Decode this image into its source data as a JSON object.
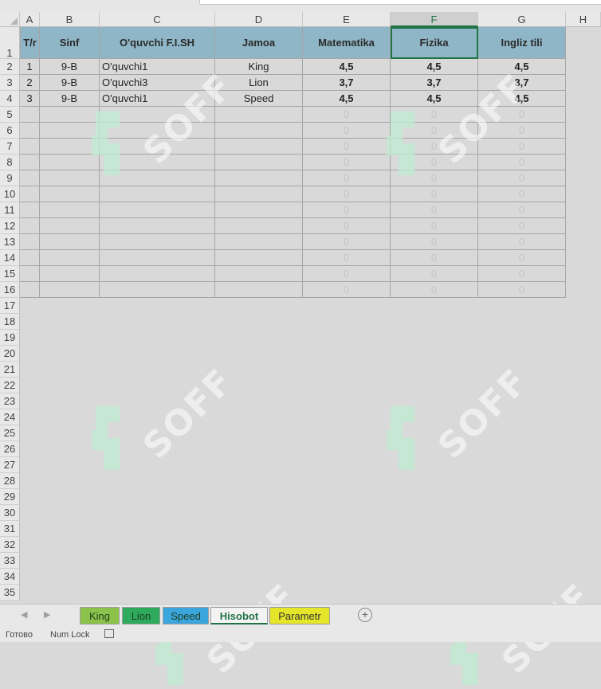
{
  "columns": [
    "A",
    "B",
    "C",
    "D",
    "E",
    "F",
    "G",
    "H"
  ],
  "selected_column": "F",
  "header_row": {
    "tr": "T/r",
    "sinf": "Sinf",
    "fish": "O'quvchi F.I.SH",
    "jamoa": "Jamoa",
    "matematika": "Matematika",
    "fizika": "Fizika",
    "ingliz": "Ingliz tili"
  },
  "data_rows": [
    {
      "tr": "1",
      "sinf": "9-B",
      "fish": "O'quvchi1",
      "jamoa": "King",
      "matematika": "4,5",
      "fizika": "4,5",
      "ingliz": "4,5"
    },
    {
      "tr": "2",
      "sinf": "9-B",
      "fish": "O'quvchi3",
      "jamoa": "Lion",
      "matematika": "3,7",
      "fizika": "3,7",
      "ingliz": "3,7"
    },
    {
      "tr": "3",
      "sinf": "9-B",
      "fish": "O'quvchi1",
      "jamoa": "Speed",
      "matematika": "4,5",
      "fizika": "4,5",
      "ingliz": "4,5"
    }
  ],
  "zero_value": "0",
  "row_numbers": [
    "1",
    "2",
    "3",
    "4",
    "5",
    "6",
    "7",
    "8",
    "9",
    "10",
    "11",
    "12",
    "13",
    "14",
    "15",
    "16",
    "17",
    "18",
    "19",
    "20",
    "21",
    "22",
    "23",
    "24",
    "25",
    "26",
    "27",
    "28",
    "29",
    "30",
    "31",
    "32",
    "33",
    "34",
    "35"
  ],
  "watermark_text": "SOFF",
  "sheet_tabs": [
    {
      "label": "King",
      "color": "#8bc34a",
      "active": false
    },
    {
      "label": "Lion",
      "color": "#2eaa5c",
      "active": false
    },
    {
      "label": "Speed",
      "color": "#3aa6dd",
      "active": false
    },
    {
      "label": "Hisobot",
      "color": "#f3f3f3",
      "active": true
    },
    {
      "label": "Parametr",
      "color": "#e5e52a",
      "active": false
    }
  ],
  "add_sheet_icon": "plus-circle-icon",
  "status": {
    "ready": "Готово",
    "numlock": "Num Lock",
    "macro_icon": "macro-record-icon"
  }
}
